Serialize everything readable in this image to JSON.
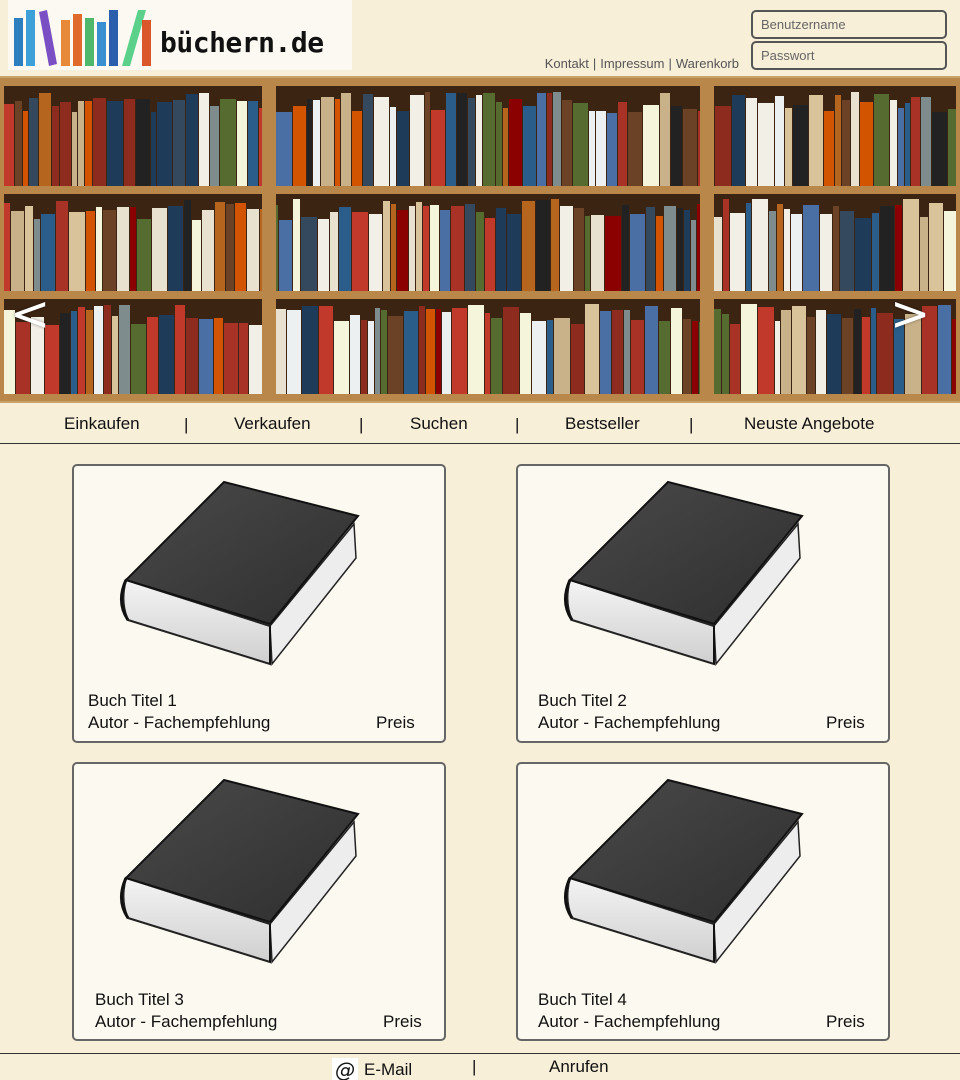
{
  "header": {
    "logo_text": "büchern.de",
    "links": [
      "Kontakt",
      "Impressum",
      "Warenkorb"
    ],
    "link_separator": "|",
    "username_placeholder": "Benutzername",
    "password_placeholder": "Passwort"
  },
  "hero": {
    "prev_label": "<",
    "next_label": ">"
  },
  "nav": {
    "items": [
      "Einkaufen",
      "Verkaufen",
      "Suchen",
      "Bestseller",
      "Neuste Angebote"
    ],
    "separator": "|"
  },
  "products": [
    {
      "title": "Buch Titel 1",
      "author": "Autor - Fachempfehlung",
      "price": "Preis"
    },
    {
      "title": "Buch Titel 2",
      "author": "Autor - Fachempfehlung",
      "price": "Preis"
    },
    {
      "title": "Buch Titel 3",
      "author": "Autor - Fachempfehlung",
      "price": "Preis"
    },
    {
      "title": "Buch Titel 4",
      "author": "Autor - Fachempfehlung",
      "price": "Preis"
    }
  ],
  "footer": {
    "email_icon": "@",
    "email_label": "E-Mail",
    "separator": "|",
    "call_label": "Anrufen"
  },
  "colors": {
    "background": "#f8efd9",
    "card_background": "#fcf9f0",
    "shelf_wood": "#b9874a"
  }
}
